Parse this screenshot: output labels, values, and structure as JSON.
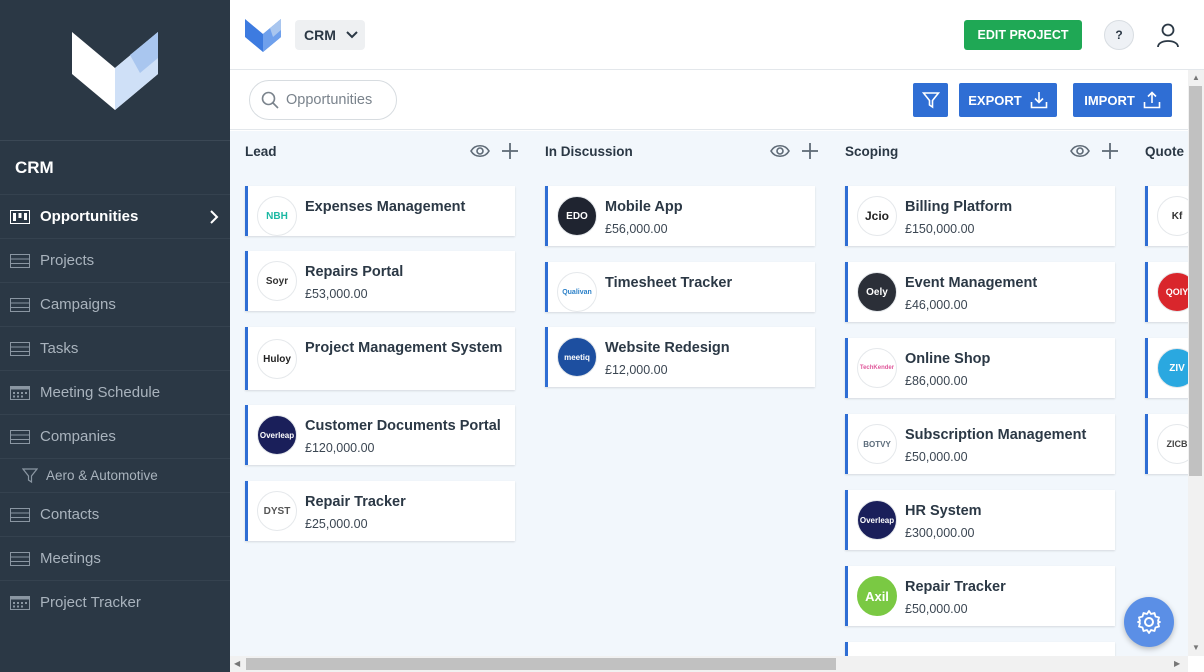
{
  "sidebar": {
    "app_title": "CRM",
    "items": [
      {
        "label": "Opportunities",
        "icon": "kanban-icon",
        "active": true
      },
      {
        "label": "Projects",
        "icon": "table-icon"
      },
      {
        "label": "Campaigns",
        "icon": "table-icon"
      },
      {
        "label": "Tasks",
        "icon": "table-icon"
      },
      {
        "label": "Meeting Schedule",
        "icon": "calendar-icon"
      },
      {
        "label": "Companies",
        "icon": "table-icon"
      },
      {
        "label": "Aero & Automotive",
        "icon": "filter-icon",
        "sub": true
      },
      {
        "label": "Contacts",
        "icon": "table-icon"
      },
      {
        "label": "Meetings",
        "icon": "table-icon"
      },
      {
        "label": "Project Tracker",
        "icon": "calendar-icon"
      }
    ]
  },
  "header": {
    "project_select": "CRM",
    "edit_project_label": "EDIT PROJECT",
    "help_label": "?"
  },
  "toolbar": {
    "search_placeholder": "Opportunities",
    "export_label": "EXPORT",
    "import_label": "IMPORT"
  },
  "board": {
    "columns": [
      {
        "title": "Lead",
        "cards": [
          {
            "title": "Expenses Management",
            "value": "",
            "logo_text": "NBH",
            "logo_color": "#1bb8a3"
          },
          {
            "title": "Repairs Portal",
            "value": "£53,000.00",
            "logo_text": "Soyr",
            "logo_color": "#333333"
          },
          {
            "title": "Project Management System",
            "value": "",
            "logo_text": "Huloy",
            "logo_color": "#222222"
          },
          {
            "title": "Customer Documents Portal",
            "value": "£120,000.00",
            "logo_text": "Overleap",
            "logo_color": "#ffffff"
          },
          {
            "title": "Repair Tracker",
            "value": "£25,000.00",
            "logo_text": "DYST",
            "logo_color": "#555555"
          }
        ]
      },
      {
        "title": "In Discussion",
        "cards": [
          {
            "title": "Mobile App",
            "value": "£56,000.00",
            "logo_text": "EDO",
            "logo_color": "#ffffff"
          },
          {
            "title": "Timesheet Tracker",
            "value": "",
            "logo_text": "Qualivan",
            "logo_color": "#2b80c8"
          },
          {
            "title": "Website Redesign",
            "value": "£12,000.00",
            "logo_text": "meetiq",
            "logo_color": "#ffffff"
          }
        ]
      },
      {
        "title": "Scoping",
        "cards": [
          {
            "title": "Billing Platform",
            "value": "£150,000.00",
            "logo_text": "Jcio",
            "logo_color": "#222222"
          },
          {
            "title": "Event Management",
            "value": "£46,000.00",
            "logo_text": "Oely",
            "logo_color": "#ffffff"
          },
          {
            "title": "Online Shop",
            "value": "£86,000.00",
            "logo_text": "TechKender",
            "logo_color": "#e05a9c"
          },
          {
            "title": "Subscription Management",
            "value": "£50,000.00",
            "logo_text": "BOTVY",
            "logo_color": "#5b6b7a"
          },
          {
            "title": "HR System",
            "value": "£300,000.00",
            "logo_text": "Overleap",
            "logo_color": "#ffffff"
          },
          {
            "title": "Repair Tracker",
            "value": "£50,000.00",
            "logo_text": "Axil",
            "logo_color": "#ffffff"
          }
        ]
      },
      {
        "title": "Quote",
        "cards": [
          {
            "title": "",
            "value": "",
            "logo_text": "Kf",
            "logo_color": "#333333"
          },
          {
            "title": "",
            "value": "",
            "logo_text": "QOIY",
            "logo_color": "#ffffff"
          },
          {
            "title": "",
            "value": "",
            "logo_text": "ZIV",
            "logo_color": "#ffffff"
          },
          {
            "title": "",
            "value": "",
            "logo_text": "ZICB",
            "logo_color": "#444444"
          }
        ]
      }
    ]
  },
  "colors": {
    "sidebar_bg": "#2b3845",
    "accent_blue": "#2f6ed4",
    "edit_green": "#1fa855",
    "board_bg": "#f2f7fc"
  }
}
